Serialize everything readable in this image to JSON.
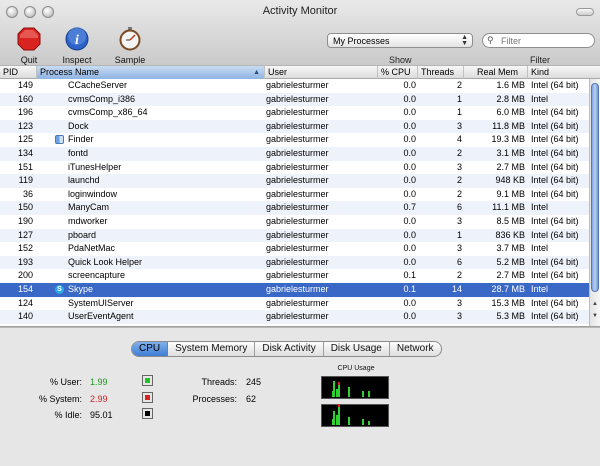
{
  "window": {
    "title": "Activity Monitor"
  },
  "toolbar": {
    "quit": "Quit Process",
    "inspect": "Inspect",
    "sample": "Sample Process",
    "show_value": "My Processes",
    "show_label": "Show",
    "filter_placeholder": "Filter",
    "filter_label": "Filter"
  },
  "columns": {
    "pid": "PID",
    "name": "Process Name",
    "user": "User",
    "cpu": "% CPU",
    "threads": "Threads",
    "mem": "Real Mem",
    "kind": "Kind"
  },
  "processes": [
    {
      "pid": "149",
      "name": "CCacheServer",
      "user": "gabrielesturmer",
      "cpu": "0.0",
      "threads": "2",
      "mem": "1.6 MB",
      "kind": "Intel (64 bit)"
    },
    {
      "pid": "160",
      "name": "cvmsComp_i386",
      "user": "gabrielesturmer",
      "cpu": "0.0",
      "threads": "1",
      "mem": "2.8 MB",
      "kind": "Intel"
    },
    {
      "pid": "196",
      "name": "cvmsComp_x86_64",
      "user": "gabrielesturmer",
      "cpu": "0.0",
      "threads": "1",
      "mem": "6.0 MB",
      "kind": "Intel (64 bit)"
    },
    {
      "pid": "123",
      "name": "Dock",
      "user": "gabrielesturmer",
      "cpu": "0.0",
      "threads": "3",
      "mem": "11.8 MB",
      "kind": "Intel (64 bit)"
    },
    {
      "pid": "125",
      "name": "Finder",
      "user": "gabrielesturmer",
      "cpu": "0.0",
      "threads": "4",
      "mem": "19.3 MB",
      "kind": "Intel (64 bit)",
      "icon": "finder"
    },
    {
      "pid": "134",
      "name": "fontd",
      "user": "gabrielesturmer",
      "cpu": "0.0",
      "threads": "2",
      "mem": "3.1 MB",
      "kind": "Intel (64 bit)"
    },
    {
      "pid": "151",
      "name": "iTunesHelper",
      "user": "gabrielesturmer",
      "cpu": "0.0",
      "threads": "3",
      "mem": "2.7 MB",
      "kind": "Intel (64 bit)"
    },
    {
      "pid": "119",
      "name": "launchd",
      "user": "gabrielesturmer",
      "cpu": "0.0",
      "threads": "2",
      "mem": "948 KB",
      "kind": "Intel (64 bit)"
    },
    {
      "pid": "36",
      "name": "loginwindow",
      "user": "gabrielesturmer",
      "cpu": "0.0",
      "threads": "2",
      "mem": "9.1 MB",
      "kind": "Intel (64 bit)"
    },
    {
      "pid": "150",
      "name": "ManyCam",
      "user": "gabrielesturmer",
      "cpu": "0.7",
      "threads": "6",
      "mem": "11.1 MB",
      "kind": "Intel"
    },
    {
      "pid": "190",
      "name": "mdworker",
      "user": "gabrielesturmer",
      "cpu": "0.0",
      "threads": "3",
      "mem": "8.5 MB",
      "kind": "Intel (64 bit)"
    },
    {
      "pid": "127",
      "name": "pboard",
      "user": "gabrielesturmer",
      "cpu": "0.0",
      "threads": "1",
      "mem": "836 KB",
      "kind": "Intel (64 bit)"
    },
    {
      "pid": "152",
      "name": "PdaNetMac",
      "user": "gabrielesturmer",
      "cpu": "0.0",
      "threads": "3",
      "mem": "3.7 MB",
      "kind": "Intel"
    },
    {
      "pid": "193",
      "name": "Quick Look Helper",
      "user": "gabrielesturmer",
      "cpu": "0.0",
      "threads": "6",
      "mem": "5.2 MB",
      "kind": "Intel (64 bit)"
    },
    {
      "pid": "200",
      "name": "screencapture",
      "user": "gabrielesturmer",
      "cpu": "0.1",
      "threads": "2",
      "mem": "2.7 MB",
      "kind": "Intel (64 bit)"
    },
    {
      "pid": "154",
      "name": "Skype",
      "user": "gabrielesturmer",
      "cpu": "0.1",
      "threads": "14",
      "mem": "28.7 MB",
      "kind": "Intel",
      "icon": "skype",
      "selected": true
    },
    {
      "pid": "124",
      "name": "SystemUIServer",
      "user": "gabrielesturmer",
      "cpu": "0.0",
      "threads": "3",
      "mem": "15.3 MB",
      "kind": "Intel (64 bit)"
    },
    {
      "pid": "140",
      "name": "UserEventAgent",
      "user": "gabrielesturmer",
      "cpu": "0.0",
      "threads": "3",
      "mem": "5.3 MB",
      "kind": "Intel (64 bit)"
    }
  ],
  "tabs": [
    "CPU",
    "System Memory",
    "Disk Activity",
    "Disk Usage",
    "Network"
  ],
  "cpu_stats": {
    "user_label": "% User:",
    "user_value": "1.99",
    "user_color": "#1a9a1a",
    "system_label": "% System:",
    "system_value": "2.99",
    "system_color": "#d11f1f",
    "idle_label": "% Idle:",
    "idle_value": "95.01",
    "idle_color": "#000000",
    "threads_label": "Threads:",
    "threads_value": "245",
    "processes_label": "Processes:",
    "processes_value": "62",
    "usage_title": "CPU Usage"
  },
  "colors": {
    "selection": "#3a68c7",
    "user_swatch": "#22c422",
    "system_swatch": "#dd2222",
    "idle_swatch": "#000000"
  }
}
